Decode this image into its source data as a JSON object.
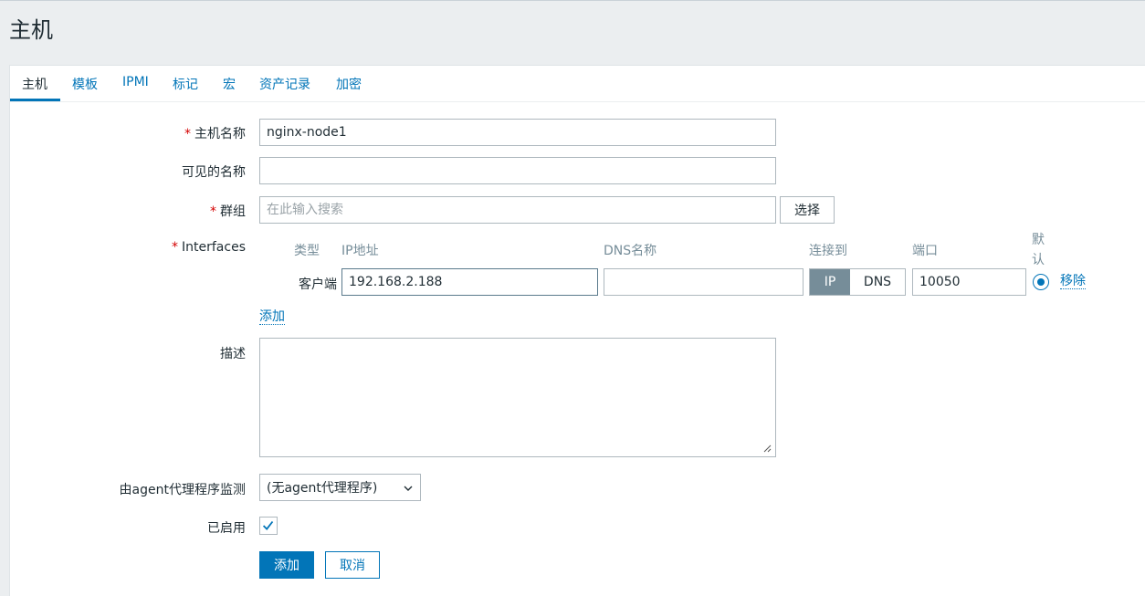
{
  "page": {
    "title": "主机"
  },
  "tabs": [
    {
      "label": "主机",
      "active": true
    },
    {
      "label": "模板"
    },
    {
      "label": "IPMI"
    },
    {
      "label": "标记"
    },
    {
      "label": "宏"
    },
    {
      "label": "资产记录"
    },
    {
      "label": "加密"
    }
  ],
  "form": {
    "required_mark": "*",
    "hostname": {
      "label": "主机名称",
      "value": "nginx-node1"
    },
    "visible_name": {
      "label": "可见的名称",
      "value": ""
    },
    "groups": {
      "label": "群组",
      "placeholder": "在此输入搜索",
      "select_button": "选择"
    },
    "interfaces": {
      "label": "Interfaces",
      "columns": {
        "type": "类型",
        "ip": "IP地址",
        "dns": "DNS名称",
        "connect_to": "连接到",
        "port": "端口",
        "default_line1": "默",
        "default_line2": "认"
      },
      "row": {
        "type": "客户端",
        "ip": "192.168.2.188",
        "dns": "",
        "connect_ip": "IP",
        "connect_dns": "DNS",
        "connect_selected": "IP",
        "port": "10050",
        "default_selected": true,
        "remove": "移除"
      },
      "add_link": "添加"
    },
    "description": {
      "label": "描述",
      "value": ""
    },
    "proxy": {
      "label": "由agent代理程序监测",
      "selected": "(无agent代理程序)"
    },
    "enabled": {
      "label": "已启用",
      "checked": true
    },
    "buttons": {
      "add": "添加",
      "cancel": "取消"
    }
  },
  "colors": {
    "accent": "#0275b8",
    "required": "#d40000",
    "segment_active": "#768d99"
  }
}
